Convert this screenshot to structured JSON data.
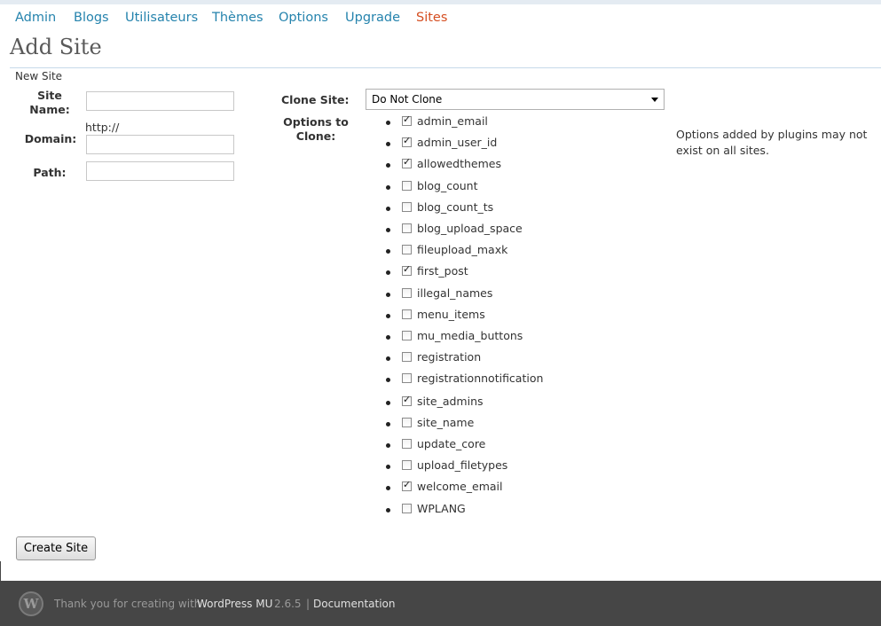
{
  "nav": {
    "items": [
      {
        "label": "Admin"
      },
      {
        "label": "Blogs"
      },
      {
        "label": "Utilisateurs"
      },
      {
        "label": "Thèmes"
      },
      {
        "label": "Options"
      },
      {
        "label": "Upgrade"
      },
      {
        "label": "Sites",
        "current": true
      }
    ]
  },
  "page": {
    "title": "Add Site",
    "section_legend": "New Site"
  },
  "form": {
    "site_name_label": "Site Name:",
    "domain_label": "Domain:",
    "domain_prefix": "http://",
    "path_label": "Path:",
    "site_name_value": "",
    "domain_value": "",
    "path_value": "",
    "clone_site_label": "Clone Site:",
    "clone_site_value": "Do Not Clone",
    "options_label": "Options to Clone:",
    "options_note": "Options added by plugins may not exist on all sites.",
    "submit_label": "Create Site"
  },
  "options": [
    {
      "name": "admin_email",
      "checked": true
    },
    {
      "name": "admin_user_id",
      "checked": true
    },
    {
      "name": "allowedthemes",
      "checked": true
    },
    {
      "name": "blog_count",
      "checked": false
    },
    {
      "name": "blog_count_ts",
      "checked": false
    },
    {
      "name": "blog_upload_space",
      "checked": false
    },
    {
      "name": "fileupload_maxk",
      "checked": false
    },
    {
      "name": "first_post",
      "checked": true
    },
    {
      "name": "illegal_names",
      "checked": false
    },
    {
      "name": "menu_items",
      "checked": false
    },
    {
      "name": "mu_media_buttons",
      "checked": false
    },
    {
      "name": "registration",
      "checked": false
    },
    {
      "name": "registrationnotification",
      "checked": false
    },
    {
      "name": "site_admins",
      "checked": true
    },
    {
      "name": "site_name",
      "checked": false
    },
    {
      "name": "update_core",
      "checked": false
    },
    {
      "name": "upload_filetypes",
      "checked": false
    },
    {
      "name": "welcome_email",
      "checked": true
    },
    {
      "name": "WPLANG",
      "checked": false
    }
  ],
  "footer": {
    "thanks_text": "Thank you for creating with",
    "product_link": "WordPress MU",
    "version": "2.6.5",
    "separator": "|",
    "docs_link": "Documentation"
  },
  "colors": {
    "link": "#2583ad",
    "current": "#d54e21",
    "footer_bg": "#464646"
  }
}
